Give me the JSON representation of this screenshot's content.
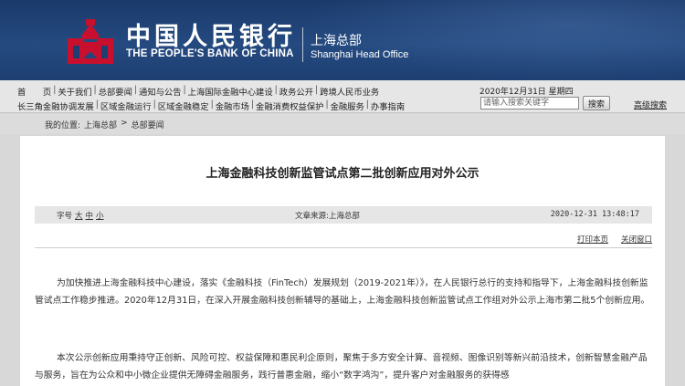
{
  "header": {
    "bank_name_cn": "中国人民银行",
    "bank_name_en": "THE PEOPLE'S BANK OF CHINA",
    "office_cn": "上海总部",
    "office_en": "Shanghai Head Office",
    "logo_icon": "pboc-logo-icon",
    "colors": {
      "banner": "#1b3a6b",
      "logo": "#c8102e"
    }
  },
  "nav": {
    "row1": [
      "首　　页",
      "关于我们",
      "总部要闻",
      "通知与公告",
      "上海国际金融中心建设",
      "政务公开",
      "跨境人民币业务"
    ],
    "row2": [
      "长三角金融协调发展",
      "区域金融运行",
      "区域金融稳定",
      "金融市场",
      "金融消费权益保护",
      "金融服务",
      "办事指南"
    ],
    "separator": "|",
    "date": "2020年12月31日  星期四",
    "search_placeholder": "请输入搜索关键字",
    "search_button": "搜索",
    "advanced_search": "高级搜索"
  },
  "breadcrumb": {
    "label": "我的位置:",
    "items": [
      "上海总部",
      "总部要闻"
    ],
    "separator": ">"
  },
  "article": {
    "title": "上海金融科技创新监管试点第二批创新应用对外公示",
    "font_size_label": "字号",
    "font_size_options": [
      "大",
      "中",
      "小"
    ],
    "source": "文章来源:上海总部",
    "timestamp": "2020-12-31  13:48:17",
    "print_label": "打印本页",
    "close_label": "关闭窗口",
    "paragraph1": "为加快推进上海金融科技中心建设，落实《金融科技（FinTech）发展规划（2019-2021年）》，在人民银行总行的支持和指导下，上海金融科技创新监管试点工作稳步推进。2020年12月31日，在深入开展金融科技创新辅导的基础上，上海金融科技创新监管试点工作组对外公示上海市第二批5个创新应用。",
    "paragraph2": "本次公示创新应用秉持守正创新、风险可控、权益保障和惠民利企原则，聚焦于多方安全计算、音视频、图像识别等新兴前沿技术，创新智慧金融产品与服务，旨在为公众和中小微企业提供无障碍金融服务，践行普惠金融，缩小“数字鸿沟”，提升客户对金融服务的获得感"
  }
}
